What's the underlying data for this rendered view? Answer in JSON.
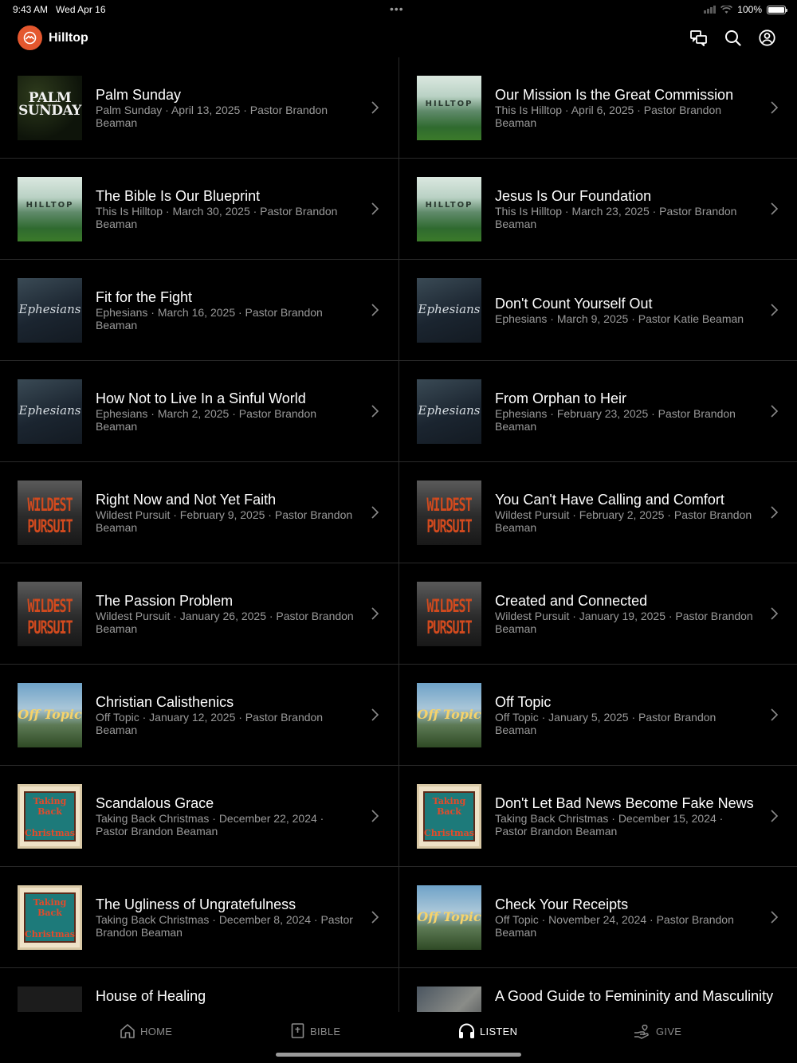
{
  "status": {
    "time": "9:43 AM",
    "date": "Wed Apr 16",
    "battery": "100%"
  },
  "header": {
    "app_name": "Hilltop",
    "icons": [
      "chat-icon",
      "search-icon",
      "account-icon"
    ]
  },
  "sermons": [
    {
      "title": "Palm Sunday",
      "meta": "Palm Sunday · April 13, 2025 · Pastor Brandon Beaman",
      "art": "palm",
      "art_text": "PALM SUNDAY"
    },
    {
      "title": "Our Mission Is the Great Commission",
      "meta": "This Is Hilltop · April 6, 2025 · Pastor Brandon Beaman",
      "art": "hilltop",
      "art_text": "HILLTOP"
    },
    {
      "title": "The Bible Is Our Blueprint",
      "meta": "This Is Hilltop · March 30, 2025 · Pastor Brandon Beaman",
      "art": "hilltop",
      "art_text": "HILLTOP"
    },
    {
      "title": "Jesus Is Our Foundation",
      "meta": "This Is Hilltop · March 23, 2025 · Pastor Brandon Beaman",
      "art": "hilltop",
      "art_text": "HILLTOP"
    },
    {
      "title": "Fit for the Fight",
      "meta": "Ephesians · March 16, 2025 · Pastor Brandon Beaman",
      "art": "ephesians",
      "art_text": "Ephesians"
    },
    {
      "title": "Don't Count Yourself Out",
      "meta": "Ephesians · March 9, 2025 · Pastor Katie Beaman",
      "art": "ephesians",
      "art_text": "Ephesians"
    },
    {
      "title": "How Not to Live In a Sinful World",
      "meta": "Ephesians · March 2, 2025 · Pastor Brandon Beaman",
      "art": "ephesians",
      "art_text": "Ephesians"
    },
    {
      "title": "From Orphan to Heir",
      "meta": "Ephesians · February 23, 2025 · Pastor Brandon Beaman",
      "art": "ephesians",
      "art_text": "Ephesians"
    },
    {
      "title": "Right Now and Not Yet Faith",
      "meta": "Wildest Pursuit · February 9, 2025 · Pastor Brandon Beaman",
      "art": "wildest",
      "art_text": "WILDEST PURSUIT"
    },
    {
      "title": "You Can't Have Calling and Comfort",
      "meta": "Wildest Pursuit · February 2, 2025 · Pastor Brandon Beaman",
      "art": "wildest",
      "art_text": "WILDEST PURSUIT"
    },
    {
      "title": "The Passion Problem",
      "meta": "Wildest Pursuit · January 26, 2025 · Pastor Brandon Beaman",
      "art": "wildest",
      "art_text": "WILDEST PURSUIT"
    },
    {
      "title": "Created and Connected",
      "meta": "Wildest Pursuit · January 19, 2025 · Pastor Brandon Beaman",
      "art": "wildest",
      "art_text": "WILDEST PURSUIT"
    },
    {
      "title": "Christian Calisthenics",
      "meta": "Off Topic · January 12, 2025 · Pastor Brandon Beaman",
      "art": "offtopic",
      "art_text": "Off Topic"
    },
    {
      "title": "Off Topic",
      "meta": "Off Topic · January 5, 2025 · Pastor Brandon Beaman",
      "art": "offtopic",
      "art_text": "Off Topic"
    },
    {
      "title": "Scandalous Grace",
      "meta": "Taking Back Christmas · December 22, 2024 · Pastor Brandon Beaman",
      "art": "christmas",
      "art_text": "Taking Back Christmas"
    },
    {
      "title": "Don't Let Bad News Become Fake News",
      "meta": "Taking Back Christmas · December 15, 2024 · Pastor Brandon Beaman",
      "art": "christmas",
      "art_text": "Taking Back Christmas"
    },
    {
      "title": "The Ugliness of Ungratefulness",
      "meta": "Taking Back Christmas · December 8, 2024 · Pastor Brandon Beaman",
      "art": "christmas",
      "art_text": "Taking Back Christmas"
    },
    {
      "title": "Check Your Receipts",
      "meta": "Off Topic · November 24, 2024 · Pastor Brandon Beaman",
      "art": "offtopic",
      "art_text": "Off Topic"
    },
    {
      "title": "House of Healing",
      "meta": "",
      "art": "dark",
      "art_text": ""
    },
    {
      "title": "A Good Guide to Femininity and Masculinity",
      "meta": "",
      "art": "photo",
      "art_text": ""
    }
  ],
  "tabs": [
    {
      "label": "HOME",
      "icon": "home-icon",
      "active": false
    },
    {
      "label": "BIBLE",
      "icon": "bible-icon",
      "active": false
    },
    {
      "label": "LISTEN",
      "icon": "headphones-icon",
      "active": true
    },
    {
      "label": "GIVE",
      "icon": "give-icon",
      "active": false
    }
  ],
  "colors": {
    "accent": "#e4572e",
    "background": "#000000",
    "divider": "#2a2a2a",
    "meta_text": "#9a9a9a"
  }
}
